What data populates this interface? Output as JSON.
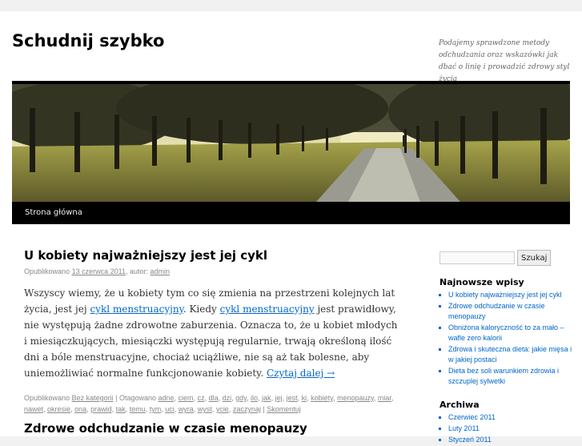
{
  "site": {
    "title": "Schudnij szybko",
    "description": "Podajemy sprawdzone metody odchudzania oraz wskazówki jak dbać o linię i prowadzić zdrowy styl życia"
  },
  "nav": {
    "home": "Strona główna"
  },
  "post1": {
    "title": "U kobiety najważniejszy jest jej cykl",
    "meta_prefix": "Opublikowano",
    "date": "13 czerwca 2011",
    "author_prefix": ", autor:",
    "author": "admin",
    "p1": "Wszyscy wiemy, że u kobiety tym co się zmienia na przestrzeni kolejnych lat życia, jest jej",
    "link1": "cykl menstruacyjny",
    "p2": ". Kiedy",
    "link2": "cykl menstruacyjny",
    "p3": "jest prawidłowy, nie występują żadne zdrowotne zaburzenia. Oznacza to, że u kobiet młodych i miesiączkujących, miesiączki występują regularnie, trwają określoną ilość dni a bóle menstruacyjne, chociaż uciążliwe, nie są aż tak bolesne, aby uniemożliwiać normalne funkcjonowanie kobiety.",
    "read_more": "Czytaj dalej →",
    "cat_prefix": "Opublikowano",
    "category": "Bez kategorii",
    "tag_prefix": "| Otagowano",
    "tags": [
      "adne",
      "ciem",
      "cz",
      "dla",
      "dzi",
      "gdy",
      "ilo",
      "jak",
      "jej",
      "jest",
      "ki",
      "kobiety",
      "menopauzy",
      "miar",
      "nawet",
      "okresie",
      "ona",
      "prawid",
      "tak",
      "temu",
      "tym",
      "uci",
      "wyra",
      "wyst",
      "ycie",
      "zaczynaj"
    ],
    "comment": "Skomentuj"
  },
  "post2": {
    "title": "Zdrowe odchudzanie w czasie menopauzy"
  },
  "sidebar": {
    "search_button": "Szukaj",
    "recent_title": "Najnowsze wpisy",
    "recent": [
      "U kobiety najważniejszy jest jej cykl",
      "Zdrowe odchudzanie w czasie menopauzy",
      "Obniżona kaloryczność to za mało – wafle zero kalorii",
      "Zdrowa i skuteczna dieta: jakie mięsa i w jakiej postaci",
      "Dieta bez soli warunkiem zdrowia i szczuplej sylwetki"
    ],
    "archive_title": "Archiwa",
    "archive": [
      "Czerwiec 2011",
      "Luty 2011",
      "Styczeń 2011"
    ]
  }
}
